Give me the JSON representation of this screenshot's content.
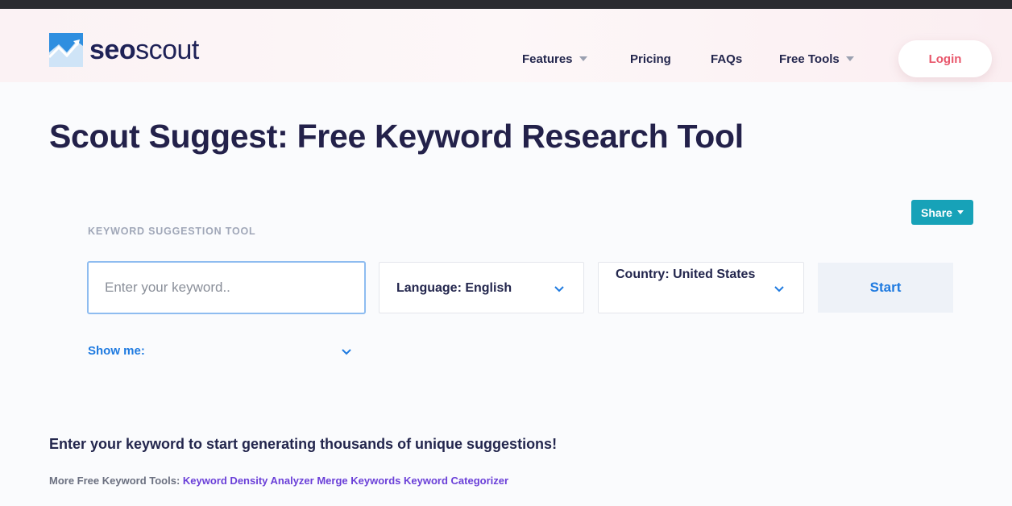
{
  "brand": {
    "name_part1": "seo",
    "name_part2": "scout"
  },
  "nav": {
    "features": "Features",
    "pricing": "Pricing",
    "faqs": "FAQs",
    "free_tools": "Free Tools",
    "login": "Login"
  },
  "page": {
    "title": "Scout Suggest: Free Keyword Research Tool"
  },
  "share": {
    "label": "Share"
  },
  "tool": {
    "section_label": "KEYWORD SUGGESTION TOOL",
    "keyword_placeholder": "Enter your keyword..",
    "keyword_value": "",
    "language_label": "Language: English",
    "country_label": "Country: United States",
    "start_label": "Start",
    "show_me_label": "Show me:"
  },
  "footer": {
    "headline": "Enter your keyword to start generating thousands of unique suggestions!",
    "more_label": "More Free Keyword Tools:",
    "links": [
      "Keyword Density Analyzer",
      "Merge Keywords",
      "Keyword Categorizer"
    ]
  },
  "colors": {
    "accent_blue": "#1e7ae0",
    "share_teal": "#17a2b8",
    "login_red": "#e8566b",
    "title_navy": "#23214a",
    "link_purple": "#6a3fd8"
  },
  "icons": {
    "logo": "chart-logo-icon",
    "nav_caret": "caret-down-icon",
    "select_chevron": "chevron-down-icon"
  }
}
